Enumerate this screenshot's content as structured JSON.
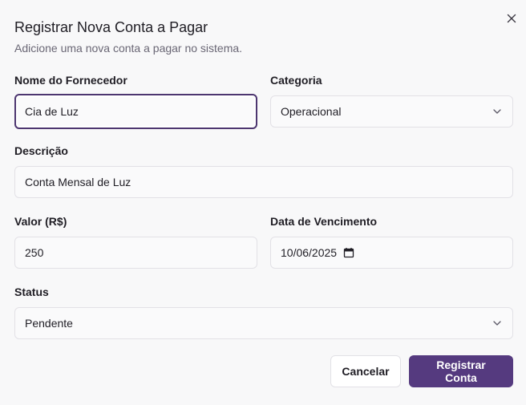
{
  "dialog": {
    "title": "Registrar Nova Conta a Pagar",
    "subtitle": "Adicione uma nova conta a pagar no sistema.",
    "close_icon": "close-icon"
  },
  "form": {
    "supplier": {
      "label": "Nome do Fornecedor",
      "value": "Cia de Luz"
    },
    "category": {
      "label": "Categoria",
      "value": "Operacional",
      "icon": "chevron-down-icon"
    },
    "description": {
      "label": "Descrição",
      "value": "Conta Mensal de Luz"
    },
    "amount": {
      "label": "Valor (R$)",
      "value": "250"
    },
    "due_date": {
      "label": "Data de Vencimento",
      "value": "10/06/2025",
      "icon": "calendar-icon"
    },
    "status": {
      "label": "Status",
      "value": "Pendente",
      "icon": "chevron-down-icon"
    }
  },
  "actions": {
    "cancel_label": "Cancelar",
    "submit_label": "Registrar Conta"
  },
  "colors": {
    "accent": "#553a7f",
    "focus_ring": "#4d3670",
    "background": "#f8f8f9",
    "border": "#e2e1e6"
  }
}
